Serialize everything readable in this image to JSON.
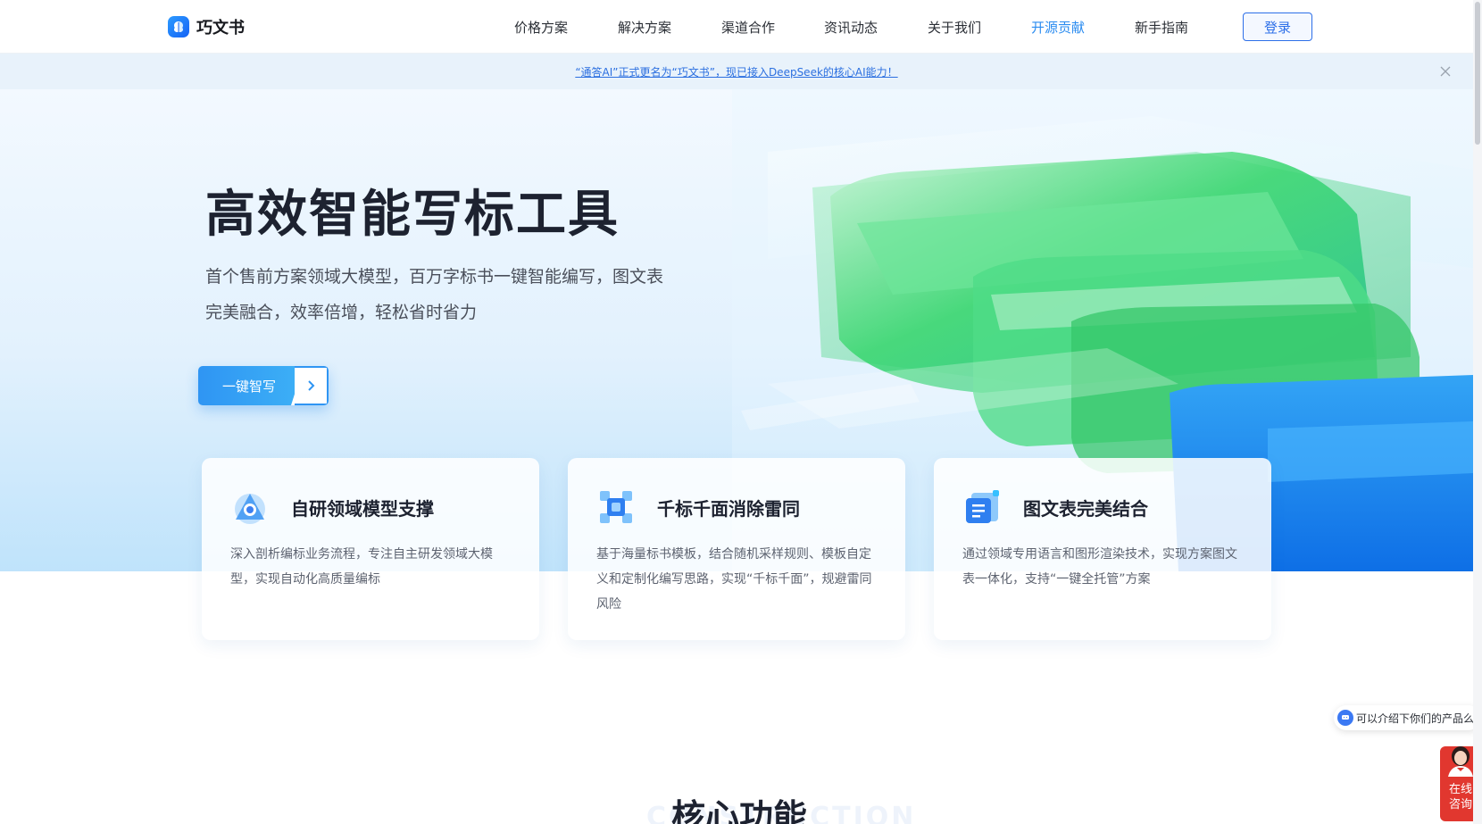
{
  "header": {
    "logo_text": "巧文书",
    "nav": [
      "价格方案",
      "解决方案",
      "渠道合作",
      "资讯动态",
      "关于我们",
      "开源贡献",
      "新手指南"
    ],
    "active_nav": "开源贡献",
    "login_label": "登录"
  },
  "notice": {
    "text": "“通答AI”正式更名为“巧文书”，现已接入DeepSeek的核心AI能力！"
  },
  "hero": {
    "title": "高效智能写标工具",
    "description_line1": "首个售前方案领域大模型，百万字标书一键智能编写，图文表",
    "description_line2": "完美融合，效率倍增，轻松省时省力",
    "cta_label": "一键智写"
  },
  "features": [
    {
      "icon": "triangle-node-icon",
      "title": "自研领域模型支撑",
      "description": "深入剖析编标业务流程，专注自主研发领域大模型，实现自动化高质量编标"
    },
    {
      "icon": "grid-puzzle-icon",
      "title": "千标千面消除雷同",
      "description": "基于海量标书模板，结合随机采样规则、模板自定义和定制化编写思路，实现“千标千面”，规避雷同风险"
    },
    {
      "icon": "document-table-icon",
      "title": "图文表完美结合",
      "description": "通过领域专用语言和图形渲染技术，实现方案图文表一体化，支持“一键全托管”方案"
    }
  ],
  "section": {
    "title": "核心功能",
    "background_word": "CONSTRUCTION"
  },
  "chat": {
    "bubble_text": "可以介绍下你们的产品么",
    "consult_line1": "在线",
    "consult_line2": "咨询"
  },
  "colors": {
    "brand": "#2d6fe8",
    "active_nav": "#2b8cf0",
    "consult": "#e1372f"
  }
}
